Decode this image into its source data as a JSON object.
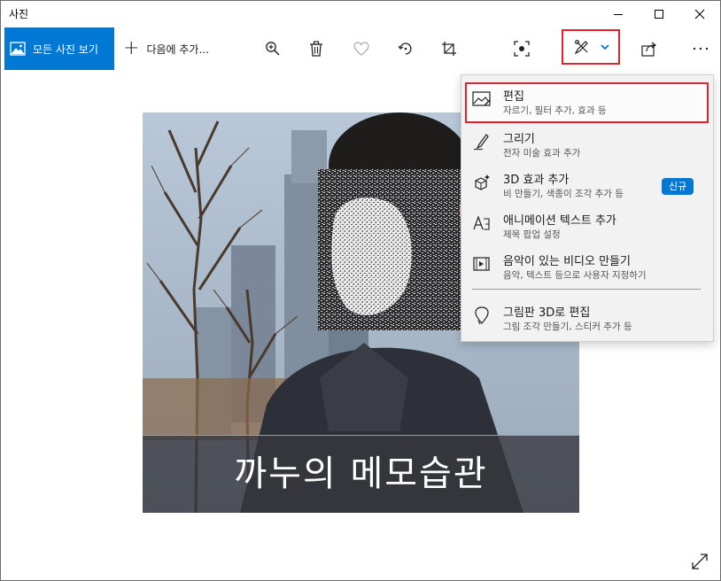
{
  "window": {
    "title": "사진"
  },
  "toolbar": {
    "see_all_label": "모든 사진 보기",
    "add_to_label": "다음에 추가...",
    "icons": [
      "zoom-in-icon",
      "delete-icon",
      "favorite-heart-icon",
      "rotate-icon",
      "crop-icon",
      "enhance-icon",
      "edit-create-icon",
      "chevron-down-icon",
      "share-icon",
      "more-icon"
    ]
  },
  "photo": {
    "caption": "까누의 메모습관"
  },
  "menu": {
    "items": [
      {
        "title": "편집",
        "subtitle": "자르기, 필터 추가, 효과 등",
        "icon": "edit-image-icon"
      },
      {
        "title": "그리기",
        "subtitle": "전자 미술 효과 추가",
        "icon": "draw-pen-icon"
      },
      {
        "title": "3D 효과 추가",
        "subtitle": "비 만들기, 색종이 조각 추가 등",
        "icon": "3d-effects-icon",
        "badge": "신규"
      },
      {
        "title": "애니메이션 텍스트 추가",
        "subtitle": "제목 팝업 설정",
        "icon": "animated-text-icon"
      },
      {
        "title": "음악이 있는 비디오 만들기",
        "subtitle": "음악, 텍스트 등으로 사용자 지정하기",
        "icon": "video-music-icon"
      },
      {
        "title": "그림판 3D로 편집",
        "subtitle": "그림 조각 만들기, 스티커 추가 등",
        "icon": "paint3d-icon"
      }
    ]
  },
  "colors": {
    "accent": "#0078d4",
    "highlight": "#e2202a"
  }
}
